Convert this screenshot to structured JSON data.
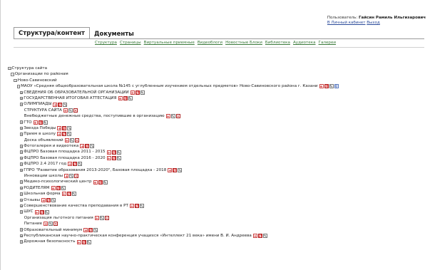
{
  "user": {
    "label": "Пользователь:",
    "name": "Гайсин Рамиль Ильгизарович",
    "cabinet_link": "В Личный кабинет",
    "logout_link": "Выход"
  },
  "tabs": [
    {
      "label": "Структура/контент",
      "active": true
    },
    {
      "label": "Документы",
      "active": false
    }
  ],
  "subnav": [
    "Структура",
    "Страницы",
    "Виртуальные приемные",
    "Видеоблоги",
    "Новостные Блоки",
    "Библиотека",
    "Аудиотека",
    "Галереи"
  ],
  "tree": [
    {
      "level": 0,
      "text": "Структура сайта",
      "expander": "−",
      "actions": []
    },
    {
      "level": 1,
      "text": "Организации по районам",
      "expander": "−",
      "actions": []
    },
    {
      "level": 2,
      "text": "Ново-Савиновский",
      "expander": "−",
      "actions": []
    },
    {
      "level": 3,
      "text": "МАОУ «Средняя общеобразовательная школа №145 с углубленным изучением отдельных предметов» Ново-Савиновского района г. Казани",
      "expander": "−",
      "actions": [
        "add",
        "mv",
        "ed",
        "vw"
      ]
    },
    {
      "level": 4,
      "text": "СВЕДЕНИЯ ОБ ОБРАЗОВАТЕЛЬНОЙ ОРГАНИЗАЦИИ",
      "expander": "+",
      "actions": [
        "add",
        "mv",
        "ed"
      ]
    },
    {
      "level": 4,
      "text": "ГОСУДАРСТВЕННАЯ ИТОГОВАЯ АТТЕСТАЦИЯ",
      "expander": "+",
      "actions": [
        "add",
        "mv",
        "ed"
      ]
    },
    {
      "level": 4,
      "text": "ОЛИМПИАДЫ",
      "expander": "+",
      "actions": [
        "add",
        "mv",
        "ed"
      ]
    },
    {
      "level": 4,
      "text": "СТРУКТУРА САЙТА",
      "expander": "",
      "actions": [
        "add",
        "ed",
        "del"
      ]
    },
    {
      "level": 4,
      "text": "Внебюджетные денежные средства, поступившие в организацию",
      "expander": "",
      "actions": [
        "add",
        "ed",
        "del"
      ]
    },
    {
      "level": 4,
      "text": "ГТО",
      "expander": "+",
      "actions": [
        "add",
        "mv",
        "ed"
      ]
    },
    {
      "level": 4,
      "text": "Звезда Победы",
      "expander": "+",
      "actions": [
        "add",
        "mv",
        "ed"
      ]
    },
    {
      "level": 4,
      "text": "Прием в школу",
      "expander": "+",
      "actions": [
        "add",
        "mv",
        "ed"
      ]
    },
    {
      "level": 4,
      "text": "Доска объявлений",
      "expander": "",
      "actions": [
        "add",
        "ed",
        "del"
      ]
    },
    {
      "level": 4,
      "text": "Фотогалерея и видеотека",
      "expander": "+",
      "actions": [
        "add",
        "mv",
        "ed"
      ]
    },
    {
      "level": 4,
      "text": "ФЦПРО Базовая площадка 2011 - 2015",
      "expander": "+",
      "actions": [
        "add",
        "mv",
        "ed"
      ]
    },
    {
      "level": 4,
      "text": "ФЦПРО Базовая площадка 2016 - 2020",
      "expander": "+",
      "actions": [
        "add",
        "mv",
        "ed"
      ]
    },
    {
      "level": 4,
      "text": "ФЦПРО 2.4 2017 год",
      "expander": "+",
      "actions": [
        "add",
        "mv",
        "ed"
      ]
    },
    {
      "level": 4,
      "text": "ГПРО \"Развитие образования 2013-2020\", Базовая площадка - 2018",
      "expander": "+",
      "actions": [
        "add",
        "mv",
        "ed"
      ]
    },
    {
      "level": 4,
      "text": "Инновации школы",
      "expander": "",
      "actions": [
        "add",
        "ed",
        "del"
      ]
    },
    {
      "level": 4,
      "text": "Медико-психологический центр",
      "expander": "+",
      "actions": [
        "add",
        "mv",
        "ed"
      ]
    },
    {
      "level": 4,
      "text": "РОДИТЕЛЯМ",
      "expander": "+",
      "actions": [
        "add",
        "mv",
        "ed"
      ]
    },
    {
      "level": 4,
      "text": "Школьная форма",
      "expander": "+",
      "actions": [
        "add",
        "mv",
        "ed"
      ]
    },
    {
      "level": 4,
      "text": "Отзывы",
      "expander": "+",
      "actions": [
        "add",
        "mv",
        "ed"
      ]
    },
    {
      "level": 4,
      "text": "Совершенствование качества преподавания в РТ",
      "expander": "+",
      "actions": [
        "add",
        "mv",
        "ed"
      ]
    },
    {
      "level": 4,
      "text": "ШУС",
      "expander": "+",
      "actions": [
        "add",
        "mv",
        "ed"
      ]
    },
    {
      "level": 4,
      "text": "Организация льготного питания",
      "expander": "",
      "actions": [
        "add",
        "ed",
        "del"
      ]
    },
    {
      "level": 4,
      "text": "Питание",
      "expander": "",
      "actions": [
        "add",
        "ed",
        "del"
      ]
    },
    {
      "level": 4,
      "text": "Образовательный минимум",
      "expander": "+",
      "actions": [
        "add",
        "mv",
        "ed"
      ]
    },
    {
      "level": 4,
      "text": "Республиканская научно-практическая конференция учащихся «Интеллект 21 века» имени В. И. Андреева",
      "expander": "+",
      "actions": [
        "add",
        "mv",
        "ed"
      ]
    },
    {
      "level": 4,
      "text": "Дорожная безопасность",
      "expander": "+",
      "actions": [
        "add",
        "mv",
        "ed"
      ]
    }
  ]
}
